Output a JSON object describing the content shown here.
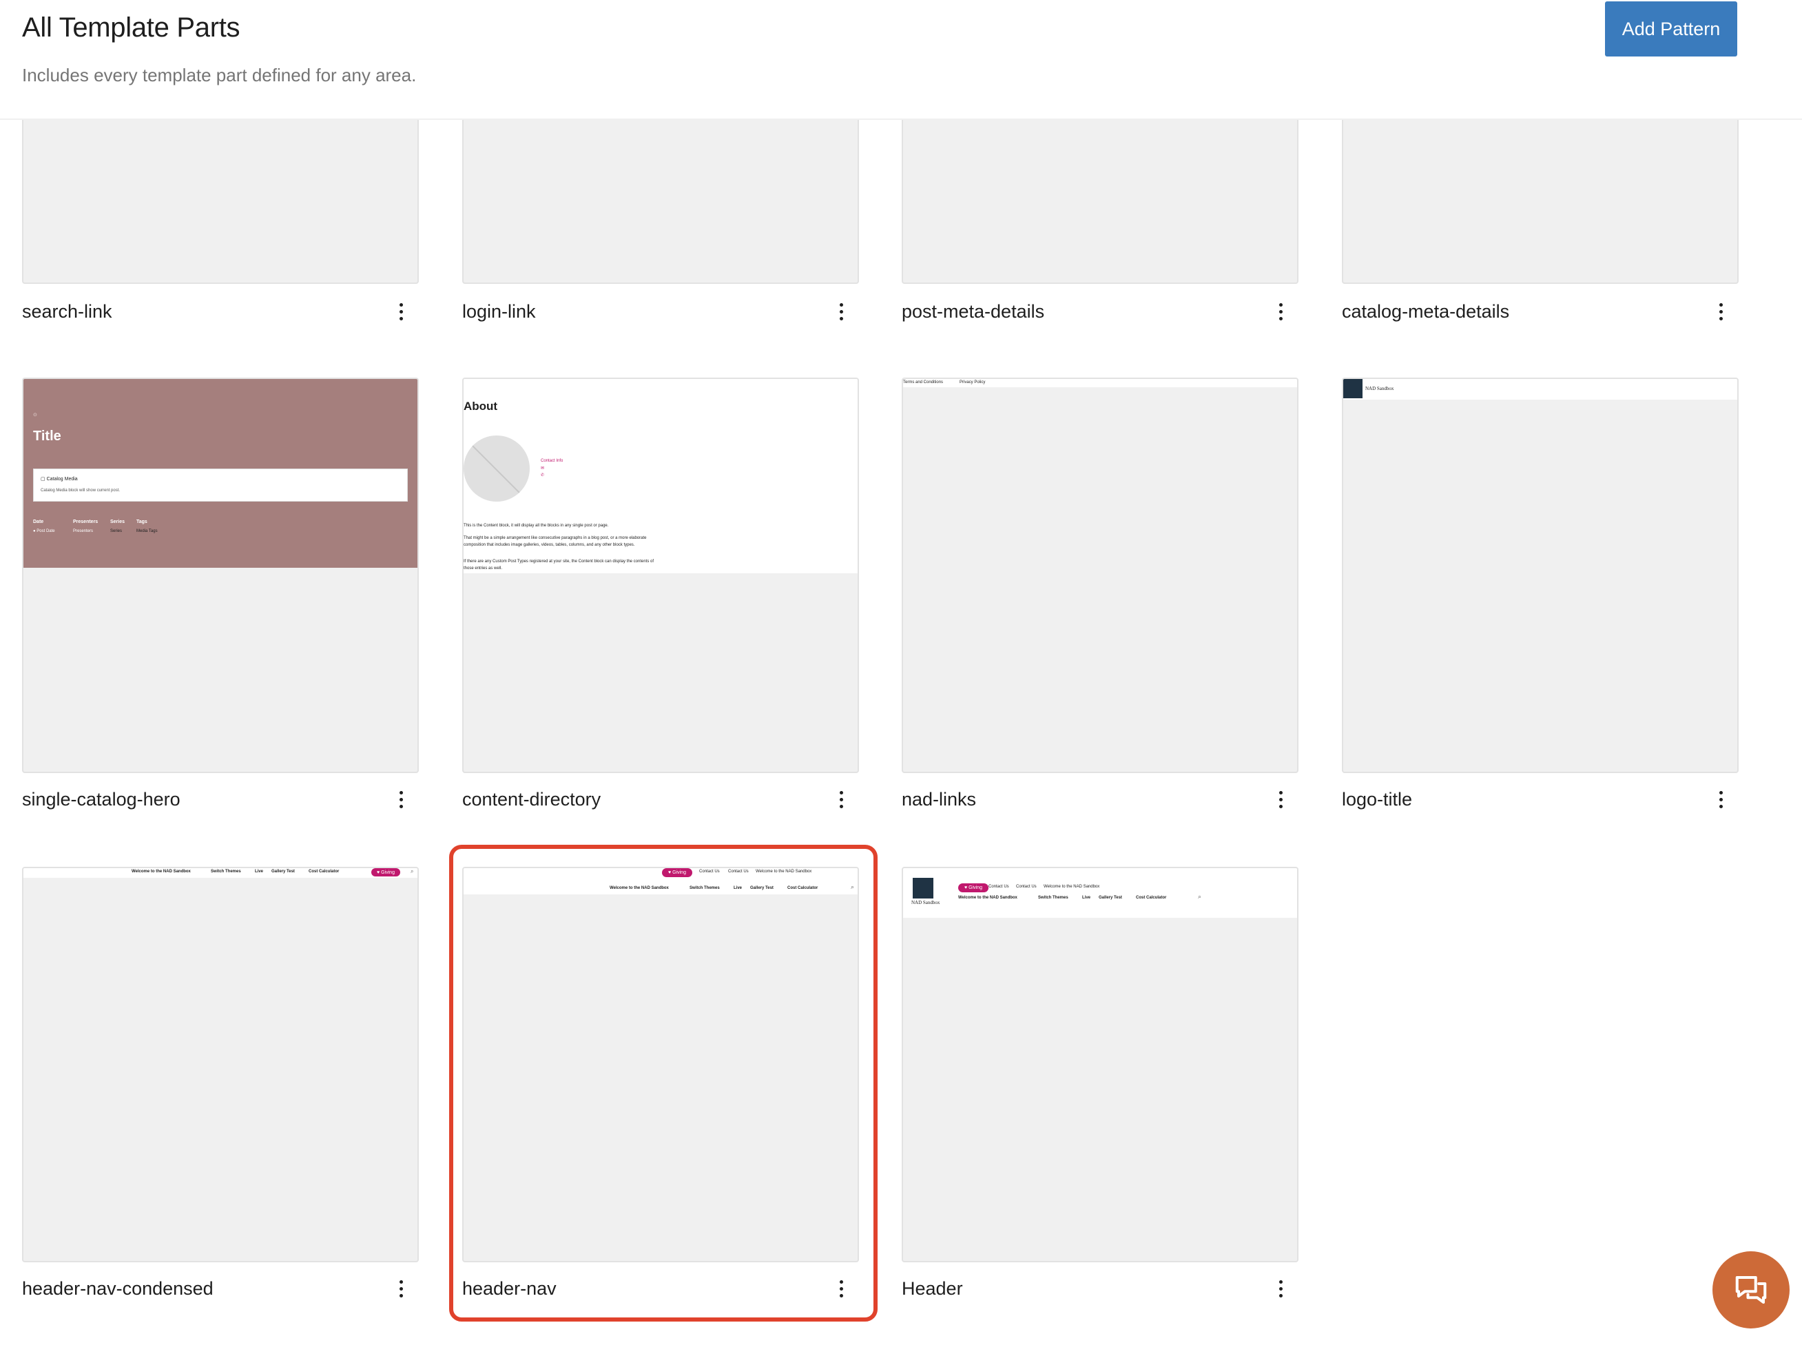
{
  "header": {
    "title": "All Template Parts",
    "description": "Includes every template part defined for any area.",
    "add_button": "Add Pattern"
  },
  "cards": [
    {
      "title": "search-link"
    },
    {
      "title": "login-link"
    },
    {
      "title": "post-meta-details"
    },
    {
      "title": "catalog-meta-details"
    },
    {
      "title": "single-catalog-hero"
    },
    {
      "title": "content-directory"
    },
    {
      "title": "nad-links"
    },
    {
      "title": "logo-title"
    },
    {
      "title": "header-nav-condensed"
    },
    {
      "title": "header-nav"
    },
    {
      "title": "Header"
    }
  ],
  "previews": {
    "hero": {
      "title": "Title",
      "media_label": "Catalog Media",
      "media_desc": "Catalog Media block will show current post.",
      "meta_headers": [
        "Date",
        "Presenters",
        "Series",
        "Tags"
      ],
      "meta_values": [
        "Post Date",
        "Presenters",
        "Series",
        "Media Tags"
      ]
    },
    "directory": {
      "heading": "About",
      "contact": "Contact Info",
      "p1": "This is the Content block, it will display all the blocks in any single post or page.",
      "p2a": "That might be a simple arrangement like consecutive paragraphs in a blog post, or a more elaborate",
      "p2b": "composition that includes image galleries, videos, tables, columns, and any other block types.",
      "p3a": "If there are any Custom Post Types registered at your site, the Content block can display the contents of",
      "p3b": "those entries as well."
    },
    "links": {
      "terms": "Terms and Conditions",
      "privacy": "Privacy Policy"
    },
    "logo": {
      "site_name": "NAD Sandbox"
    },
    "nav": {
      "items": [
        "Welcome to the NAD Sandbox",
        "Switch Themes",
        "Live",
        "Gallery Test",
        "Cost Calculator"
      ],
      "giving": "Giving",
      "top_links": [
        "Contact Us",
        "Contact Us",
        "Welcome to the NAD Sandbox"
      ]
    }
  },
  "colors": {
    "accent": "#3a7bbd",
    "hero_bg": "#a57f7d",
    "pill": "#c0186d",
    "highlight": "#e0422c",
    "chat": "#cd6a38"
  },
  "icons": {
    "more": "more-vertical-icon",
    "chat": "chat-bubbles-icon",
    "search": "search-icon"
  }
}
